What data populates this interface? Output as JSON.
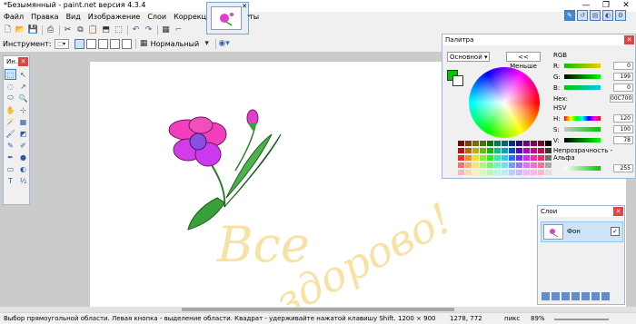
{
  "window": {
    "title": "*Безымянный - paint.net версия 4.3.4",
    "min_glyph": "—",
    "max_glyph": "❐",
    "close_glyph": "✕"
  },
  "menu": [
    "Файл",
    "Правка",
    "Вид",
    "Изображение",
    "Слои",
    "Коррекция",
    "Эффекты"
  ],
  "toolbar": {
    "tool_label": "Инструмент:",
    "blend_mode": "Нормальный"
  },
  "tools_panel": {
    "title": "Ин...",
    "close": "✕",
    "items": [
      "⬚",
      "↖",
      "◌",
      "↗",
      "⬭",
      "🔍",
      "✋",
      "⊹",
      "🪄",
      "▦",
      "🖌",
      "◩",
      "✎",
      "✐",
      "✒",
      "●",
      "▭",
      "◐",
      "T",
      "½"
    ]
  },
  "palette_panel": {
    "title": "Палитра",
    "preset": "Основной",
    "less_button": "<< Меньше",
    "rgb_header": "RGB",
    "r_label": "R:",
    "r_value": "0",
    "g_label": "G:",
    "g_value": "199",
    "b_label": "B:",
    "b_value": "0",
    "hex_label": "Hex:",
    "hex_value": "00C700",
    "hsv_header": "HSV",
    "h_label": "H:",
    "h_value": "120",
    "s_label": "S:",
    "s_value": "100",
    "v_label": "V:",
    "v_value": "78",
    "alpha_header": "Непрозрачность - Альфа",
    "alpha_value": "255",
    "primary_color": "#00c700",
    "secondary_color": "#ffffff"
  },
  "layers_panel": {
    "title": "Слои",
    "close": "✕",
    "layer_name": "Фон",
    "checked": "✓"
  },
  "canvas_text": {
    "line1": "Все",
    "line2": "здорово!"
  },
  "status": {
    "hint": "Выбор прямоугольной области. Левая кнопка - выделение области. Квадрат - удерживайте нажатой клавишу Shift.",
    "image_size": "1200 × 900",
    "cursor_pos": "1278, 772",
    "unit": "пикс",
    "zoom": "89%"
  }
}
